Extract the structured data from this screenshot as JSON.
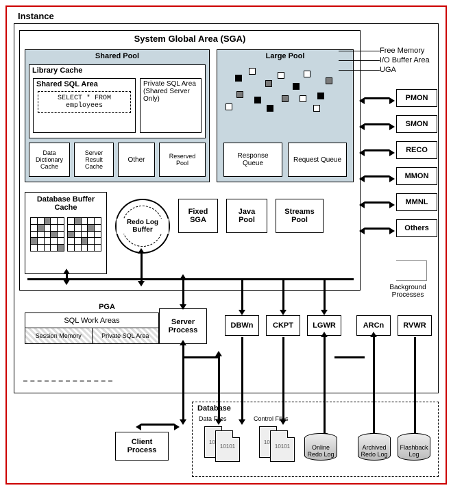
{
  "labels": {
    "instance": "Instance",
    "sga": "System Global Area (SGA)",
    "shared_pool": "Shared Pool",
    "library_cache": "Library Cache",
    "shared_sql_area": "Shared SQL Area",
    "sql_stmt": "SELECT * FROM employees",
    "private_sql_area": "Private SQL Area (Shared Server Only)",
    "data_dict_cache": "Data Dictionary Cache",
    "server_result_cache": "Server Result Cache",
    "other": "Other",
    "reserved_pool": "Reserved Pool",
    "large_pool": "Large Pool",
    "response_queue": "Response Queue",
    "request_queue": "Request Queue",
    "legend_free": "Free Memory",
    "legend_io": "I/O Buffer Area",
    "legend_uga": "UGA",
    "db_buffer_cache": "Database Buffer Cache",
    "redo_log_buffer": "Redo Log Buffer",
    "fixed_sga": "Fixed SGA",
    "java_pool": "Java Pool",
    "streams_pool": "Streams Pool",
    "bg_processes": {
      "pmon": "PMON",
      "smon": "SMON",
      "reco": "RECO",
      "mmon": "MMON",
      "mmnl": "MMNL",
      "others": "Others"
    },
    "bg_group": "Background Processes",
    "pga": "PGA",
    "sql_work_areas": "SQL Work Areas",
    "session_memory": "Session Memory",
    "private_sql_area2": "Private SQL Area",
    "server_process": "Server Process",
    "io_processes": {
      "dbwn": "DBWn",
      "ckpt": "CKPT",
      "lgwr": "LGWR",
      "arcn": "ARCn",
      "rvwr": "RVWR"
    },
    "client_process": "Client Process",
    "database": "Database",
    "data_files": "Data Files",
    "control_files": "Control Files",
    "online_redo_log": "Online Redo Log",
    "archived_redo_log": "Archived Redo Log",
    "flashback_log": "Flashback Log",
    "file_text": "10101"
  }
}
